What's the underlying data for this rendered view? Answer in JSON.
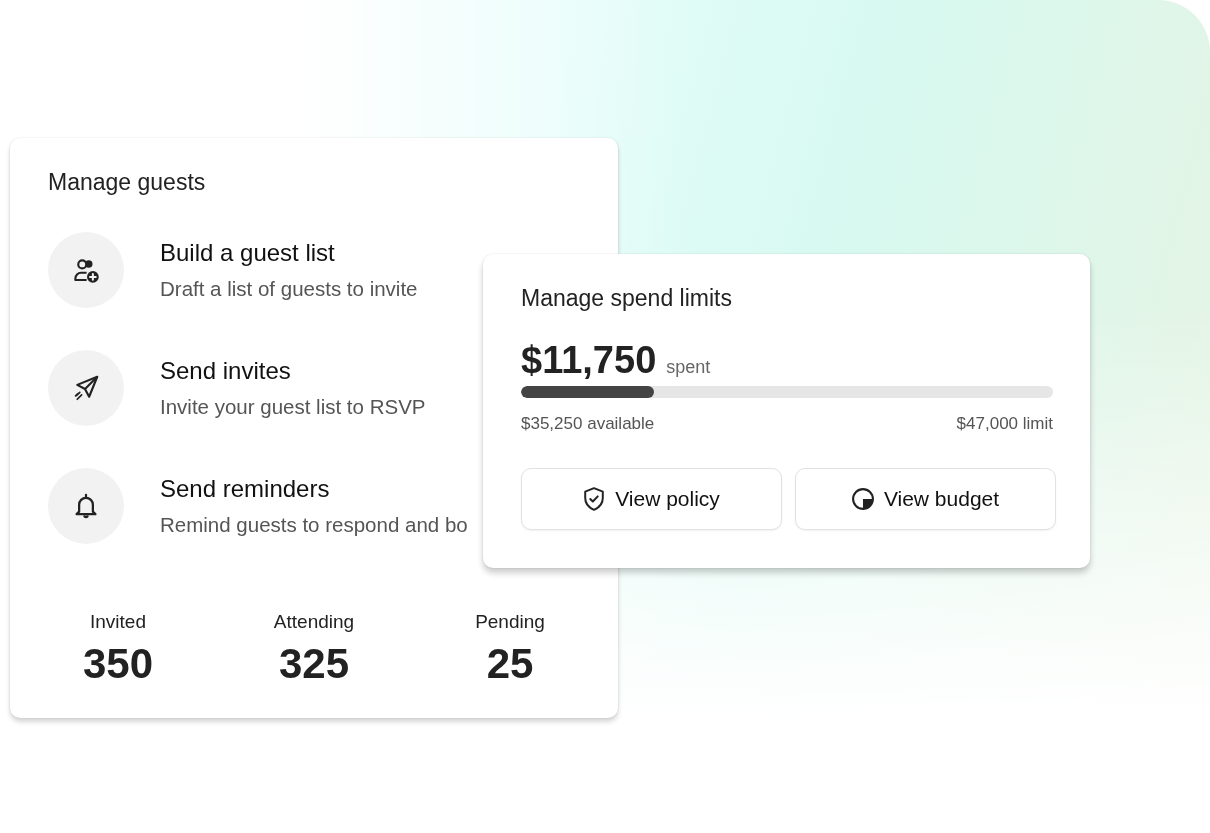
{
  "guests_card": {
    "title": "Manage guests",
    "actions": [
      {
        "kind": "guest-list",
        "title": "Build a guest list",
        "description": "Draft a list of guests to invite"
      },
      {
        "kind": "invite",
        "title": "Send invites",
        "description": "Invite your guest list to RSVP"
      },
      {
        "kind": "reminder",
        "title": "Send reminders",
        "description": "Remind guests to respond and bo"
      }
    ],
    "stats": [
      {
        "label": "Invited",
        "value": "350"
      },
      {
        "label": "Attending",
        "value": "325"
      },
      {
        "label": "Pending",
        "value": "25"
      }
    ]
  },
  "spend_card": {
    "title": "Manage spend limits",
    "amount": "$11,750",
    "amount_suffix": "spent",
    "level": 0.25,
    "available": "$35,250 available",
    "limit": "$47,000 limit",
    "buttons": [
      {
        "kind": "policy",
        "label": "View policy"
      },
      {
        "kind": "budget",
        "label": "View budget"
      }
    ]
  }
}
